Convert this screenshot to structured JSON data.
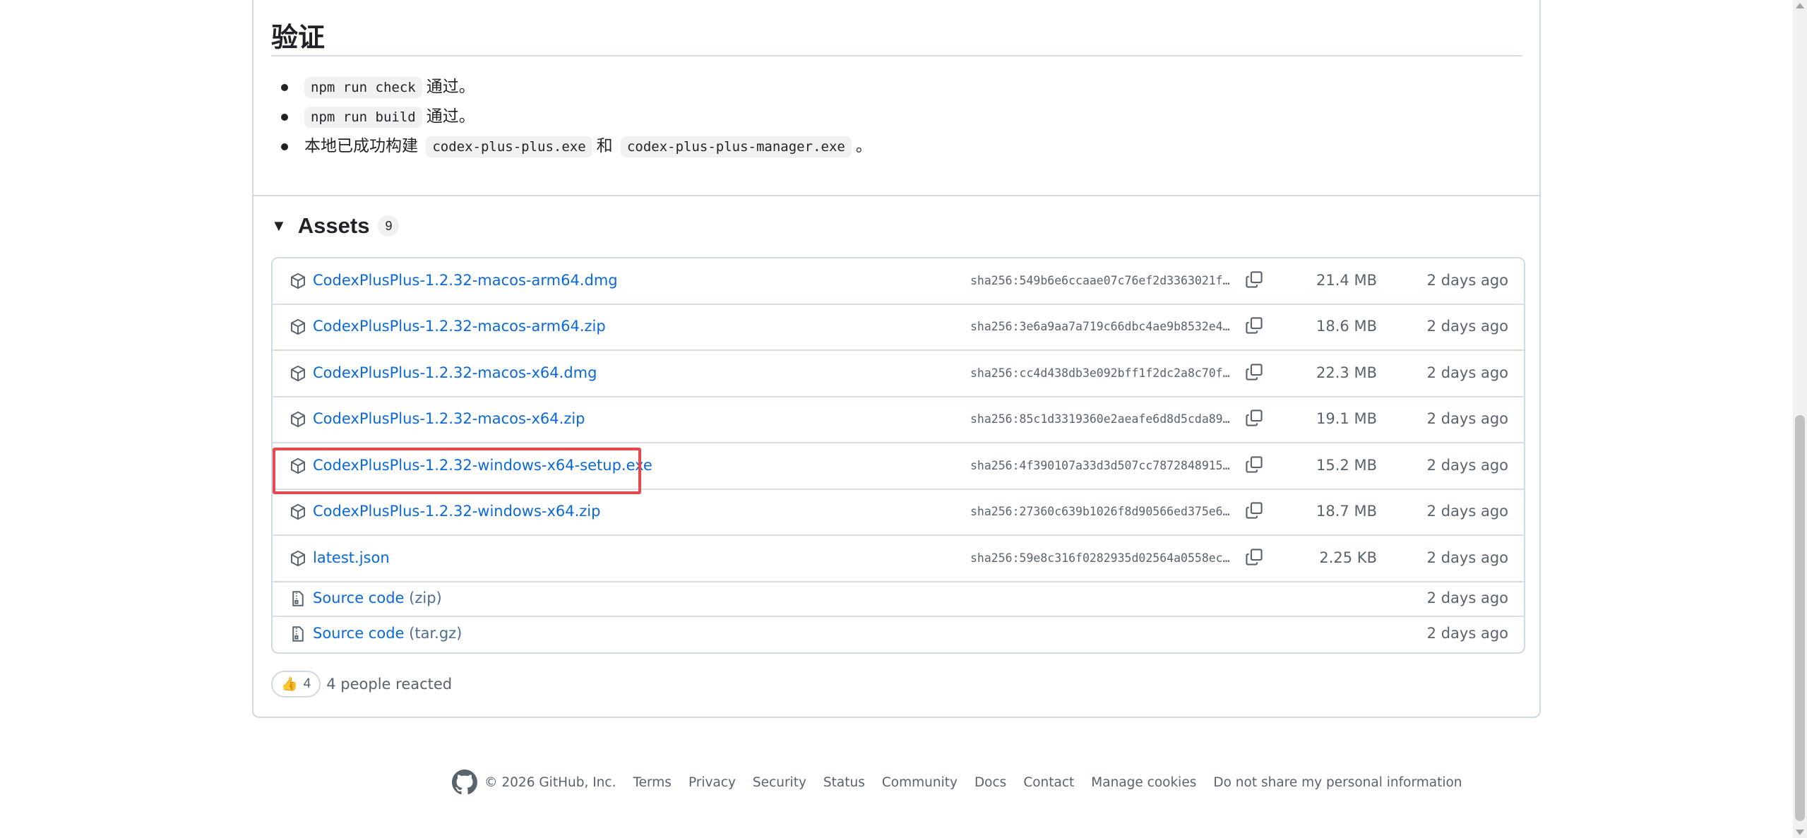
{
  "verify": {
    "title": "验证",
    "items": [
      {
        "code": "npm run check",
        "text": "通过。"
      },
      {
        "code": "npm run build",
        "text": "通过。"
      },
      {
        "prefix": "本地已成功构建",
        "code1": "codex-plus-plus.exe",
        "mid": "和",
        "code2": "codex-plus-plus-manager.exe",
        "suffix": "。"
      }
    ]
  },
  "assets": {
    "title": "Assets",
    "count": "9",
    "rows": [
      {
        "name": "CodexPlusPlus-1.2.32-macos-arm64.dmg",
        "sha": "sha256:549b6e6ccaae07c76ef2d3363021f…",
        "size": "21.4 MB",
        "date": "2 days ago"
      },
      {
        "name": "CodexPlusPlus-1.2.32-macos-arm64.zip",
        "sha": "sha256:3e6a9aa7a719c66dbc4ae9b8532e4…",
        "size": "18.6 MB",
        "date": "2 days ago"
      },
      {
        "name": "CodexPlusPlus-1.2.32-macos-x64.dmg",
        "sha": "sha256:cc4d438db3e092bff1f2dc2a8c70f…",
        "size": "22.3 MB",
        "date": "2 days ago"
      },
      {
        "name": "CodexPlusPlus-1.2.32-macos-x64.zip",
        "sha": "sha256:85c1d3319360e2aeafe6d8d5cda89…",
        "size": "19.1 MB",
        "date": "2 days ago"
      },
      {
        "name": "CodexPlusPlus-1.2.32-windows-x64-setup.exe",
        "sha": "sha256:4f390107a33d3d507cc7872848915…",
        "size": "15.2 MB",
        "date": "2 days ago"
      },
      {
        "name": "CodexPlusPlus-1.2.32-windows-x64.zip",
        "sha": "sha256:27360c639b1026f8d90566ed375e6…",
        "size": "18.7 MB",
        "date": "2 days ago"
      },
      {
        "name": "latest.json",
        "sha": "sha256:59e8c316f0282935d02564a0558ec…",
        "size": "2.25 KB",
        "date": "2 days ago"
      }
    ],
    "source": [
      {
        "name": "Source code",
        "paren": "(zip)",
        "date": "2 days ago"
      },
      {
        "name": "Source code",
        "paren": "(tar.gz)",
        "date": "2 days ago"
      }
    ]
  },
  "reactions": {
    "emoji": "👍",
    "count": "4",
    "text": "4 people reacted"
  },
  "footer": {
    "copyright": "© 2026 GitHub, Inc.",
    "links": [
      "Terms",
      "Privacy",
      "Security",
      "Status",
      "Community",
      "Docs",
      "Contact",
      "Manage cookies",
      "Do not share my personal information"
    ]
  },
  "colors": {
    "link": "#0969da",
    "muted": "#59636e",
    "border": "#d1d9e0",
    "highlight": "#e5484d"
  }
}
